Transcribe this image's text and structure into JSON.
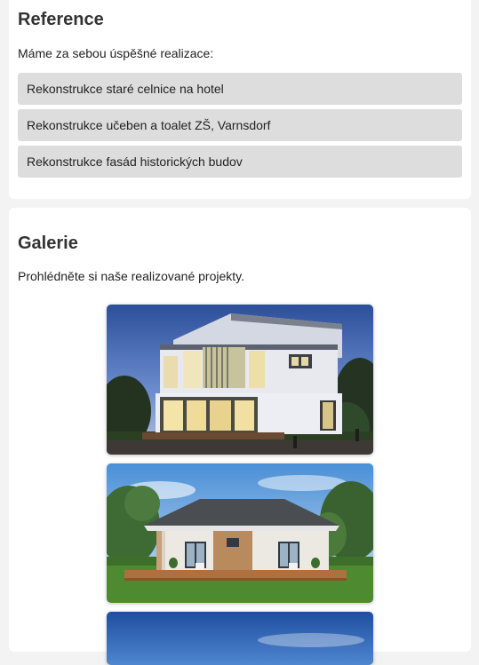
{
  "reference": {
    "title": "Reference",
    "intro": "Máme za sebou úspěšné realizace:",
    "items": [
      {
        "label": "Rekonstrukce staré celnice na hotel"
      },
      {
        "label": "Rekonstrukce učeben a toalet ZŠ, Varnsdorf"
      },
      {
        "label": "Rekonstrukce fasád historických budov"
      }
    ]
  },
  "gallery": {
    "title": "Galerie",
    "intro": "Prohlédněte si naše realizované projekty.",
    "images": [
      {
        "depicts": "modern-cube-house-dusk"
      },
      {
        "depicts": "bungalow-hip-roof-lawn"
      },
      {
        "depicts": "blue-sky-partial"
      }
    ]
  },
  "colors": {
    "page_background": "#f3f3f3",
    "card_background": "#ffffff",
    "list_item_background": "#dddddd",
    "heading_text": "#333333"
  }
}
